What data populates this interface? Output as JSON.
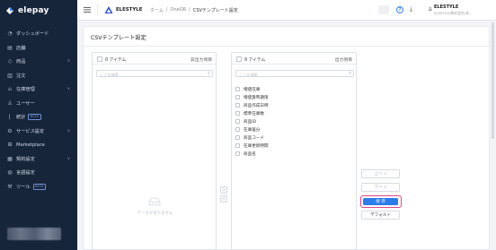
{
  "app": {
    "logo_text": "elepay"
  },
  "sidebar": {
    "items": [
      {
        "label": "ダッシュボード",
        "icon": "dashboard-icon",
        "chevron": false,
        "beta": ""
      },
      {
        "label": "店舗",
        "icon": "store-icon",
        "chevron": false,
        "beta": ""
      },
      {
        "label": "商品",
        "icon": "tag-icon",
        "chevron": true,
        "beta": ""
      },
      {
        "label": "注文",
        "icon": "order-icon",
        "chevron": false,
        "beta": ""
      },
      {
        "label": "在庫管理",
        "icon": "inventory-icon",
        "chevron": true,
        "beta": ""
      },
      {
        "label": "ユーザー",
        "icon": "user-icon",
        "chevron": false,
        "beta": ""
      },
      {
        "label": "統計",
        "icon": "chart-icon",
        "chevron": false,
        "beta": "BETA"
      },
      {
        "label": "サービス設定",
        "icon": "gear-icon",
        "chevron": true,
        "beta": ""
      },
      {
        "label": "Marketplace",
        "icon": "grid-icon",
        "chevron": false,
        "beta": ""
      },
      {
        "label": "契約設定",
        "icon": "contract-icon",
        "chevron": true,
        "beta": ""
      },
      {
        "label": "言語設定",
        "icon": "globe-icon",
        "chevron": false,
        "beta": ""
      },
      {
        "label": "ツール",
        "icon": "tool-icon",
        "chevron": false,
        "beta": "BETA"
      }
    ]
  },
  "header": {
    "store_name": "ELESTYLE",
    "breadcrumb": [
      "ホーム",
      "/",
      "OneQR",
      "/",
      "CSVテンプレート設定"
    ],
    "user_name": "ELESTYLE",
    "user_company": "ELESTYLE株式会社(本..."
  },
  "page": {
    "title": "CSVテンプレート設定",
    "left_panel": {
      "count": "0 アイテム",
      "title": "非出力項目",
      "search_placeholder": "ここを検索",
      "empty_text": "データがありません"
    },
    "right_panel": {
      "count": "9 アイテム",
      "title": "出力項目",
      "search_placeholder": "ここを検索",
      "items": [
        "増値在庫",
        "増値貨幣期限",
        "商品作成日時",
        "標準在庫数",
        "商品ID",
        "在庫差分",
        "商品コード",
        "在庫更新時間",
        "商品名"
      ]
    },
    "buttons": {
      "move_up": "上へ ∧",
      "move_down": "下へ ∨",
      "save": "保 存",
      "default": "デフォルト"
    },
    "transfer": {
      "to_right": ">",
      "to_left": "<"
    }
  },
  "colors": {
    "sidebar_bg": "#17253b",
    "primary": "#2b7de9",
    "highlight": "#e0458b"
  }
}
